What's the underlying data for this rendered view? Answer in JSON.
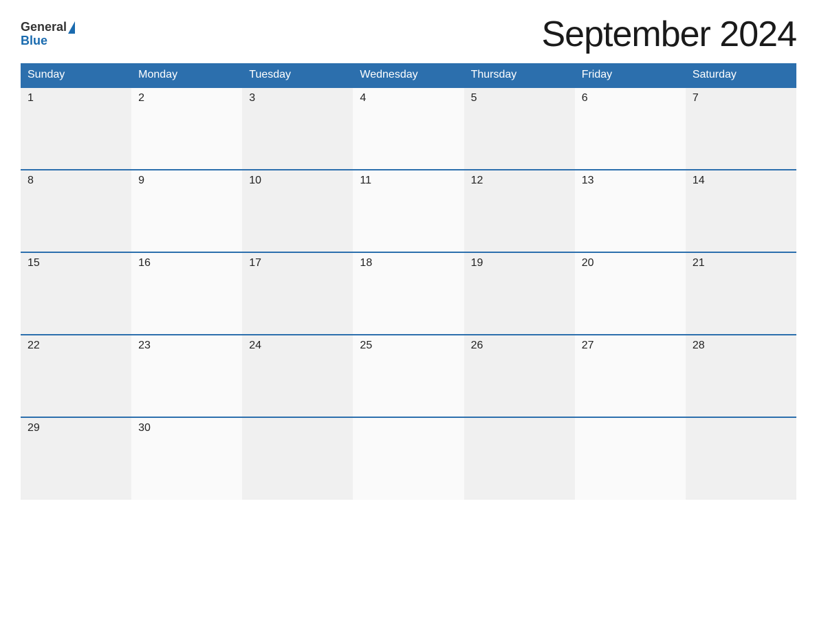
{
  "logo": {
    "general_text": "General",
    "blue_text": "Blue"
  },
  "title": "September 2024",
  "weekdays": [
    "Sunday",
    "Monday",
    "Tuesday",
    "Wednesday",
    "Thursday",
    "Friday",
    "Saturday"
  ],
  "weeks": [
    [
      {
        "day": "1"
      },
      {
        "day": "2"
      },
      {
        "day": "3"
      },
      {
        "day": "4"
      },
      {
        "day": "5"
      },
      {
        "day": "6"
      },
      {
        "day": "7"
      }
    ],
    [
      {
        "day": "8"
      },
      {
        "day": "9"
      },
      {
        "day": "10"
      },
      {
        "day": "11"
      },
      {
        "day": "12"
      },
      {
        "day": "13"
      },
      {
        "day": "14"
      }
    ],
    [
      {
        "day": "15"
      },
      {
        "day": "16"
      },
      {
        "day": "17"
      },
      {
        "day": "18"
      },
      {
        "day": "19"
      },
      {
        "day": "20"
      },
      {
        "day": "21"
      }
    ],
    [
      {
        "day": "22"
      },
      {
        "day": "23"
      },
      {
        "day": "24"
      },
      {
        "day": "25"
      },
      {
        "day": "26"
      },
      {
        "day": "27"
      },
      {
        "day": "28"
      }
    ],
    [
      {
        "day": "29"
      },
      {
        "day": "30"
      },
      {
        "day": ""
      },
      {
        "day": ""
      },
      {
        "day": ""
      },
      {
        "day": ""
      },
      {
        "day": ""
      }
    ]
  ]
}
